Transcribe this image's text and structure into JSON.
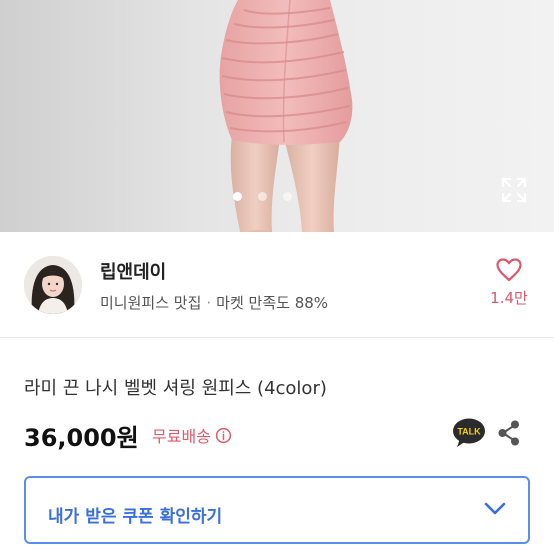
{
  "carousel": {
    "slide_count": 3,
    "active_index": 0,
    "expand_icon": "expand-fullscreen-icon"
  },
  "seller": {
    "name": "립앤데이",
    "tagline": "미니원피스 맛집",
    "separator": "·",
    "satisfaction": "마켓 만족도 88%",
    "like_count": "1.4만",
    "like_icon": "heart-outline-icon",
    "accent_color": "#e0586d"
  },
  "product": {
    "title": "라미 끈 나시 벨벳 셔링 원피스 (4color)",
    "price": "36,000원",
    "shipping": "무료배송",
    "shipping_icon": "info-circle-icon",
    "talk_label": "TALK",
    "share_icon": "share-icon"
  },
  "coupon": {
    "label": "내가 받은 쿠폰 확인하기",
    "border_color": "#5b8df0",
    "chevron_icon": "chevron-down-icon"
  }
}
